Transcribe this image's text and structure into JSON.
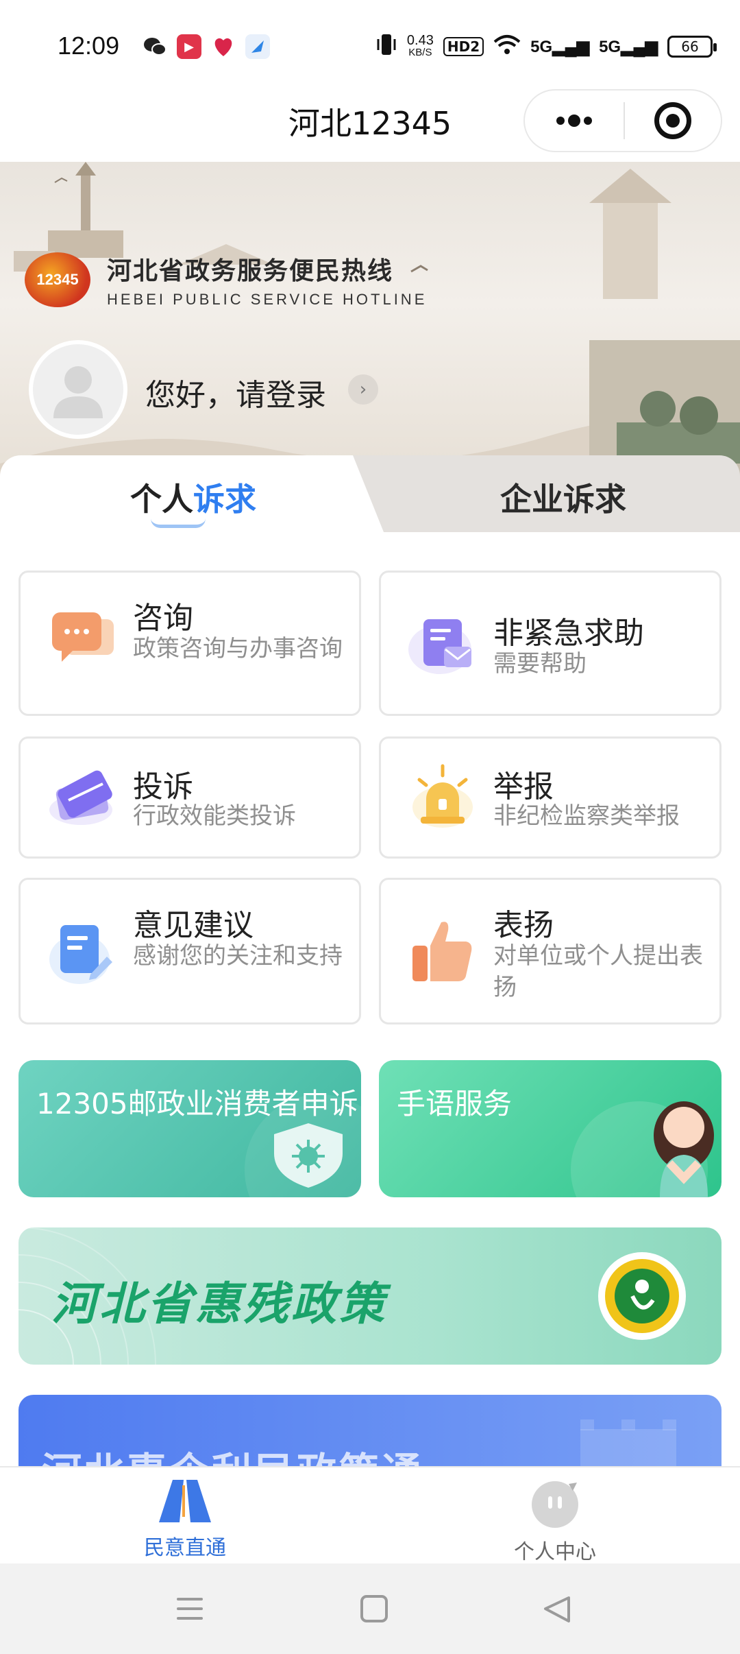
{
  "status_bar": {
    "time": "12:09",
    "speed_top": "0.43",
    "speed_bottom": "KB/S",
    "hd": "HD2",
    "signal1": "5G",
    "signal2": "5G",
    "battery": "66"
  },
  "header": {
    "title": "河北12345",
    "more_icon": "more-dots-icon",
    "close_icon": "target-close-icon"
  },
  "banner": {
    "logo_badge": "12345",
    "logo_cn": "河北省政务服务便民热线",
    "logo_en": "HEBEI PUBLIC SERVICE HOTLINE",
    "login_text": "您好，请登录",
    "login_arrow": "›"
  },
  "tabs": {
    "personal_part1": "个人",
    "personal_part2": "诉求",
    "enterprise": "企业诉求"
  },
  "services": [
    {
      "title": "咨询",
      "desc": "政策咨询与办事咨询",
      "icon": "chat-bubble-icon"
    },
    {
      "title": "非紧急求助",
      "desc": "需要帮助",
      "icon": "document-mail-icon"
    },
    {
      "title": "投诉",
      "desc": "行政效能类投诉",
      "icon": "card-send-icon"
    },
    {
      "title": "举报",
      "desc": "非纪检监察类举报",
      "icon": "alarm-light-icon"
    },
    {
      "title": "意见建议",
      "desc": "感谢您的关注和支持",
      "icon": "edit-document-icon"
    },
    {
      "title": "表扬",
      "desc": "对单位或个人提出表扬",
      "icon": "thumbs-up-icon"
    }
  ],
  "promos": {
    "postal": "12305邮政业消费者申诉",
    "sign_language": "手语服务",
    "disability_policy": "河北省惠残政策",
    "enterprise_policy": "河北惠企利民政策通"
  },
  "bottom_nav": {
    "home": "民意直通",
    "profile": "个人中心"
  },
  "colors": {
    "accent": "#2f7ef0",
    "nav_active": "#2f6fd8",
    "promo_teal": "#5fcdb4",
    "promo_green": "#3fd19b",
    "promo_blue": "#5b7ff0"
  }
}
